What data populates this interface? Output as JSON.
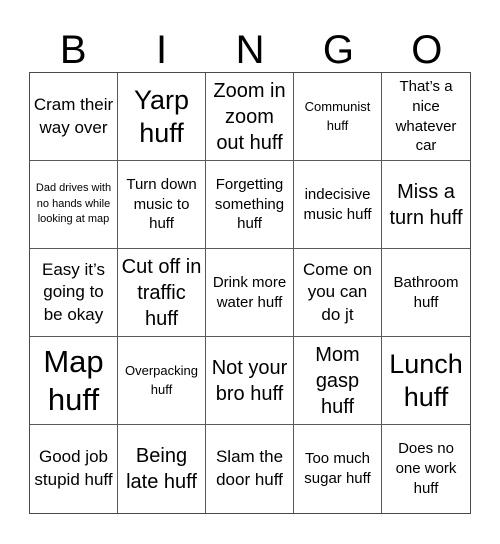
{
  "card": {
    "header": [
      "B",
      "I",
      "N",
      "G",
      "O"
    ],
    "rows": [
      [
        "Cram their way over",
        "Yarp huff",
        "Zoom in zoom out huff",
        "Communist huff",
        "That’s a nice whatever car"
      ],
      [
        "Dad drives with no hands while looking at map",
        "Turn down music to huff",
        "Forgetting something huff",
        "indecisive music huff",
        "Miss a turn huff"
      ],
      [
        "Easy it’s going to be okay",
        "Cut off in traffic huff",
        "Drink more water huff",
        "Come on you can do jt",
        "Bathroom huff"
      ],
      [
        "Map huff",
        "Overpacking huff",
        "Not your bro huff",
        "Mom gasp huff",
        "Lunch huff"
      ],
      [
        "Good job stupid huff",
        "Being late huff",
        "Slam the door huff",
        "Too much sugar huff",
        "Does no one work huff"
      ]
    ]
  }
}
